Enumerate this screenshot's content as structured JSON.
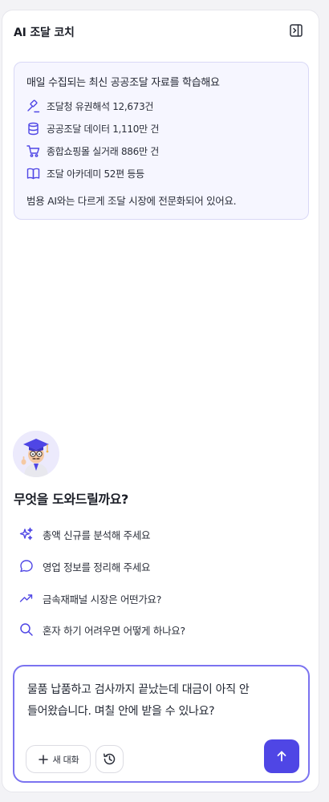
{
  "header": {
    "title": "AI 조달 코치",
    "collapse_icon": "sidebar-collapse-icon"
  },
  "info_card": {
    "heading": "매일 수집되는 최신 공공조달 자료를 학습해요",
    "stats": [
      {
        "icon": "gavel-icon",
        "text": "조달청 유권해석 12,673건"
      },
      {
        "icon": "database-icon",
        "text": "공공조달 데이터 1,110만 건"
      },
      {
        "icon": "cart-icon",
        "text": "종합쇼핑몰 실거래 886만 건"
      },
      {
        "icon": "book-icon",
        "text": "조달 아카데미 52편 등등"
      }
    ],
    "footer": "범용 AI와는 다르게 조달 시장에 전문화되어 있어요."
  },
  "greeting": "무엇을 도와드릴까요?",
  "suggestions": [
    {
      "icon": "sparkles-icon",
      "text": "총액 신규를 분석해 주세요"
    },
    {
      "icon": "chat-bubble-icon",
      "text": "영업 정보를 정리해 주세요"
    },
    {
      "icon": "trending-up-icon",
      "text": "금속재패널 시장은 어떤가요?"
    },
    {
      "icon": "search-icon",
      "text": "혼자 하기 어려우면 어떻게 하나요?"
    }
  ],
  "composer": {
    "text": "물품 납품하고 검사까지 끝났는데 대금이 아직 안 들어왔습니다. 며칠 안에 받을 수 있나요?",
    "new_chat_label": "새 대화",
    "history_icon": "history-icon",
    "send_icon": "arrow-up-icon"
  },
  "colors": {
    "accent": "#4f46e5",
    "card_bg": "#f6f6ff",
    "card_border": "#d9d8f6",
    "composer_border": "#7b73f0"
  }
}
